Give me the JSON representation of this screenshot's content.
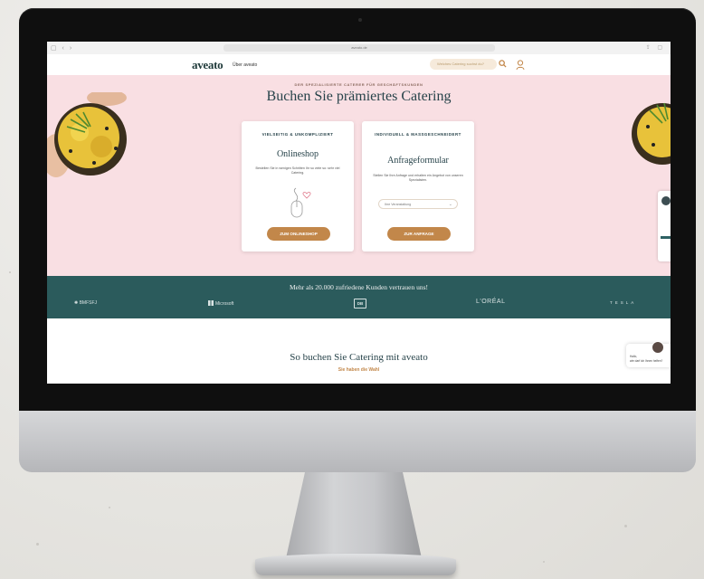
{
  "browser": {
    "url": "aveato.de"
  },
  "site": {
    "logo": "aveato",
    "nav_link": "Über aveato",
    "search_placeholder": "Welches Catering suchst du?"
  },
  "hero": {
    "eyebrow": "DER SPEZIALISIERTE CATERER FÜR GESCHÄFTSKUNDEN",
    "title": "Buchen Sie prämiertes Catering"
  },
  "cards": [
    {
      "eyebrow": "VIELSEITIG & UNKOMPLIZIERT",
      "title": "Onlineshop",
      "text": "Bestellen Sie in wenigen Schritten Ihr so viele so: sehr viel Catering.",
      "button": "ZUM ONLINESHOP"
    },
    {
      "eyebrow": "INDIVIDUELL & MASSGESCHNEIDERT",
      "title": "Anfrageformular",
      "text": "Stellen Sie Ihre Anfrage und erhalten ein Angebot von unseren Spezialisten.",
      "select_value": "Ihre Veranstaltung",
      "button": "ZUR ANFRAGE"
    }
  ],
  "trust": {
    "title": "Mehr als 20.000 zufriedene Kunden vertrauen uns!",
    "brands": [
      "BMFSFJ",
      "Microsoft",
      "DB",
      "L'ORÉAL",
      "TESLA"
    ]
  },
  "section2": {
    "title": "So buchen Sie Catering mit aveato",
    "subtitle": "Sie haben die Wahl"
  },
  "chat": {
    "line1": "Hallo,",
    "line2": "wie darf ich Ihnen helfen?"
  },
  "colors": {
    "hero_bg": "#f9dfe3",
    "accent": "#c2874a",
    "teal": "#2b5b5c",
    "heading": "#27434a"
  }
}
